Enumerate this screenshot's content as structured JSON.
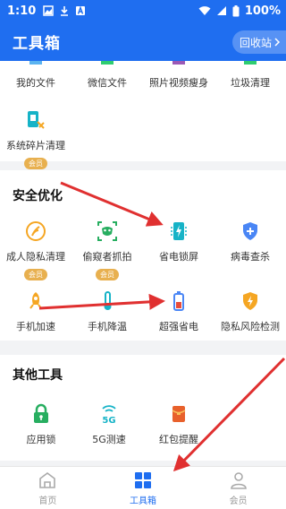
{
  "status_bar": {
    "time": "1:10",
    "battery_pct": "100%"
  },
  "app_bar": {
    "title": "工具箱",
    "recycle_label": "回收站"
  },
  "top_tools": [
    {
      "label": "我的文件"
    },
    {
      "label": "微信文件"
    },
    {
      "label": "照片视频瘦身"
    },
    {
      "label": "垃圾清理"
    }
  ],
  "fragment_tool": {
    "label": "系统碎片清理",
    "badge": "会员"
  },
  "security": {
    "title": "安全优化",
    "row1": [
      {
        "label": "成人隐私清理",
        "badge": "会员"
      },
      {
        "label": "偷窥者抓拍",
        "badge": "会员"
      },
      {
        "label": "省电锁屏"
      },
      {
        "label": "病毒查杀"
      }
    ],
    "row2": [
      {
        "label": "手机加速"
      },
      {
        "label": "手机降温"
      },
      {
        "label": "超强省电"
      },
      {
        "label": "隐私风险检测"
      }
    ]
  },
  "other": {
    "title": "其他工具",
    "items": [
      {
        "label": "应用锁"
      },
      {
        "label": "5G测速"
      },
      {
        "label": "红包提醒"
      }
    ]
  },
  "tabs": [
    {
      "label": "首页",
      "icon": "home-broom-icon"
    },
    {
      "label": "工具箱",
      "icon": "grid-icon"
    },
    {
      "label": "会员",
      "icon": "person-icon"
    }
  ],
  "colors": {
    "primary": "#1f6ef0",
    "badge": "#e8b04f",
    "green": "#27ae60",
    "orange": "#f5a623",
    "red": "#e74c3c",
    "cyan": "#16b3c7",
    "annotation_arrow": "#e03030"
  }
}
